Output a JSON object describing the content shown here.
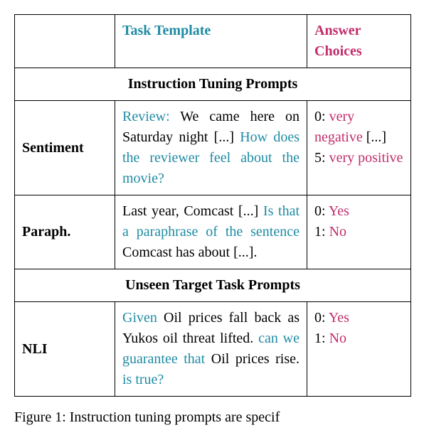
{
  "headers": {
    "col1": "",
    "col2": "Task Template",
    "col3": "Answer Choices"
  },
  "section1": "Instruction Tuning Prompts",
  "rows": [
    {
      "label": "Sentiment",
      "template_parts": {
        "p1": "Review:",
        "p2": " We came here on Saturday night [...] ",
        "p3": "How does the reviewer feel about the movie?"
      },
      "answer_parts": {
        "a0_lbl": "0: ",
        "a0_txt": "very negative",
        "a0_ell": " [...]",
        "a1_lbl": "5: ",
        "a1_txt": "very positive"
      }
    },
    {
      "label": "Paraph.",
      "template_parts": {
        "p1": "Last year, Comcast [...] ",
        "p2": "Is that a paraphrase of the sentence",
        "p3": " Comcast has about [...]."
      },
      "answer_parts": {
        "a0_lbl": "0: ",
        "a0_txt": "Yes",
        "a1_lbl": "1: ",
        "a1_txt": "No"
      }
    }
  ],
  "section2": "Unseen Target Task Prompts",
  "rows2": [
    {
      "label": "NLI",
      "template_parts": {
        "p1": "Given",
        "p2": " Oil prices fall back as Yukos oil threat lifted. ",
        "p3": "can we guarantee that",
        "p4": " Oil prices rise. ",
        "p5": "is true?"
      },
      "answer_parts": {
        "a0_lbl": "0: ",
        "a0_txt": "Yes",
        "a1_lbl": "1: ",
        "a1_txt": "No"
      }
    }
  ],
  "caption_parts": {
    "c1": "Figure 1: Instruction tuning prompts are specif"
  }
}
